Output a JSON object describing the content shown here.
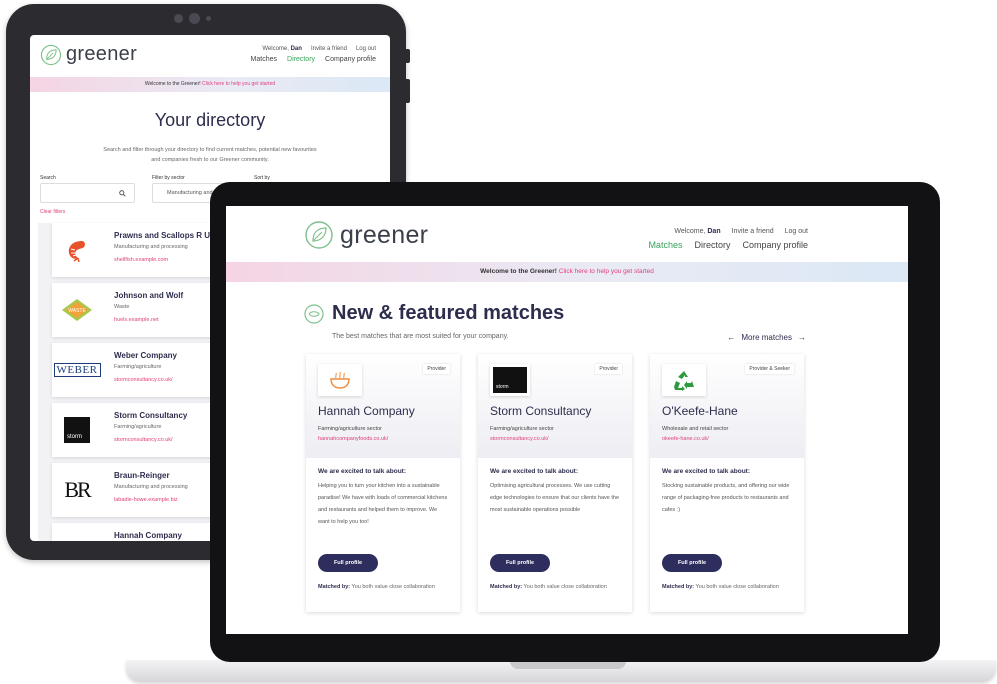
{
  "colors": {
    "accent_pink": "#e0407a",
    "accent_green": "#3aa35a",
    "navy": "#2d2d5e",
    "banner_left": "#f5d4e4",
    "banner_right": "#dbe8f5"
  },
  "brand": {
    "name": "greener"
  },
  "topbar": {
    "welcome": "Welcome,",
    "user": "Dan",
    "invite": "Invite a friend",
    "logout": "Log out"
  },
  "nav": {
    "matches": "Matches",
    "directory": "Directory",
    "company_profile": "Company profile"
  },
  "banner": {
    "text": "Welcome to the Greener!",
    "link": "Click here to help you get started"
  },
  "directory": {
    "title": "Your directory",
    "subtitle": "Search and filter through your directory to find current matches, potential new favourites and companies fresh to our Greener community.",
    "search_label": "Search",
    "filter_label": "Filter by sector",
    "filter_value": "Manufacturing and",
    "sort_label": "Sort by",
    "clear_filters": "Clear filters",
    "companies": [
      {
        "name": "Prawns and Scallops R Us",
        "sector": "Manufacturing and processing",
        "url": "shellfish.example.com",
        "icon": "shrimp-icon"
      },
      {
        "name": "Johnson and Wolf",
        "sector": "Waste",
        "url": "huels.example.net",
        "icon": "waste-logo"
      },
      {
        "name": "Weber Company",
        "sector": "Farming/agriculture",
        "url": "stormconsultancy.co.uk/",
        "icon": "weber-logo",
        "logo_text": "WEBER"
      },
      {
        "name": "Storm Consultancy",
        "sector": "Farming/agriculture",
        "url": "stormconsultancy.co.uk/",
        "icon": "storm-logo",
        "logo_text": "storm"
      },
      {
        "name": "Braun-Reinger",
        "sector": "Manufacturing and processing",
        "url": "labadie-howe.example.biz",
        "icon": "br-logo",
        "logo_text": "BR"
      },
      {
        "name": "Hannah Company",
        "sector": "",
        "url": "",
        "icon": "hannah-logo"
      }
    ]
  },
  "matches": {
    "title": "New & featured matches",
    "subtitle": "The best matches that are most suited for your company.",
    "more": "More matches",
    "talk_heading": "We are excited to talk about:",
    "full_profile": "Full profile",
    "matched_by_label": "Matched by:",
    "cards": [
      {
        "badge": "Provider",
        "name": "Hannah Company",
        "sector": "Farming/agriculture sector",
        "url": "hannahcompanyfoods.co.uk/",
        "desc": "Helping you to turn your kitchen into a sustainable paradise! We have with loads of commercial kitchens and restaurants and helped them to improve. We want to help you too!",
        "matched_by": "You both value close collaboration",
        "icon": "bowl-logo"
      },
      {
        "badge": "Provider",
        "name": "Storm Consultancy",
        "sector": "Farming/agriculture sector",
        "url": "stormconsultancy.co.uk/",
        "desc": "Optimising agricultural processes. We use cutting edge technologies to ensure that our clients have the most sustainable operations possible",
        "matched_by": "You both value close collaboration",
        "icon": "storm-logo",
        "logo_text": "storm"
      },
      {
        "badge": "Provider & Seeker",
        "name": "O'Keefe-Hane",
        "sector": "Wholesale and retail sector",
        "url": "okeefe-hane.co.uk/",
        "desc": "Stocking sustainable products, and offering our wide range of packaging-free products to restaurants and cafes :)",
        "matched_by": "You both value close collaboration",
        "icon": "recycle-logo"
      }
    ]
  }
}
